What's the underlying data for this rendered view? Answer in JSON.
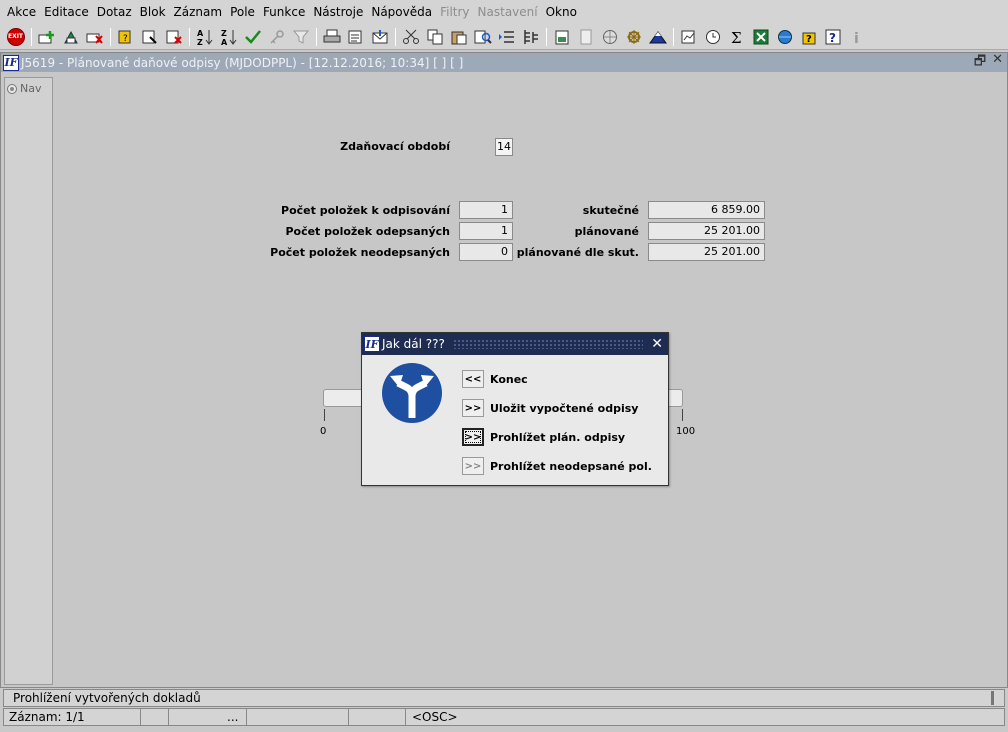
{
  "menu": [
    "Akce",
    "Editace",
    "Dotaz",
    "Blok",
    "Záznam",
    "Pole",
    "Funkce",
    "Nástroje",
    "Nápověda",
    "Filtry",
    "Nastavení",
    "Okno"
  ],
  "menu_disabled": [
    "Filtry",
    "Nastavení"
  ],
  "toolbar_exit_label": "EXIT",
  "window": {
    "title": "J5619 - Plánované daňové odpisy (MJDODPPL) - [12.12.2016; 10:34]  [ ]  [ ]",
    "nav_label": "Nav"
  },
  "form": {
    "period_label": "Zdaňovací období",
    "period_value": "14",
    "items_to_depreciate_label": "Počet položek k odpisování",
    "items_to_depreciate_value": "1",
    "items_depreciated_label": "Počet položek odepsaných",
    "items_depreciated_value": "1",
    "items_not_depreciated_label": "Počet položek neodepsaných",
    "items_not_depreciated_value": "0",
    "actual_label": "skutečné",
    "actual_value": "6 859.00",
    "planned_label": "plánované",
    "planned_value": "25 201.00",
    "planned_actual_label": "plánované dle skut.",
    "planned_actual_value": "25 201.00",
    "progress_min": "0",
    "progress_max": "100"
  },
  "dialog": {
    "title": "Jak dál ???",
    "options": [
      {
        "button": "<<",
        "label": "Konec",
        "state": "normal"
      },
      {
        "button": ">>",
        "label": "Uložit vypočtené odpisy",
        "state": "normal"
      },
      {
        "button": ">>",
        "label": "Prohlížet plán. odpisy",
        "state": "focused"
      },
      {
        "button": ">>",
        "label": "Prohlížet neodepsané pol.",
        "state": "disabled"
      }
    ]
  },
  "status": {
    "message": "Prohlížení vytvořených dokladů",
    "record": "Záznam: 1/1",
    "seg3": "...",
    "mode": "<OSC>"
  },
  "colors": {
    "dialog_title_bg": "#1f2c52",
    "window_title_bg": "#9ea9b8",
    "sign_blue": "#1f4fa0"
  }
}
